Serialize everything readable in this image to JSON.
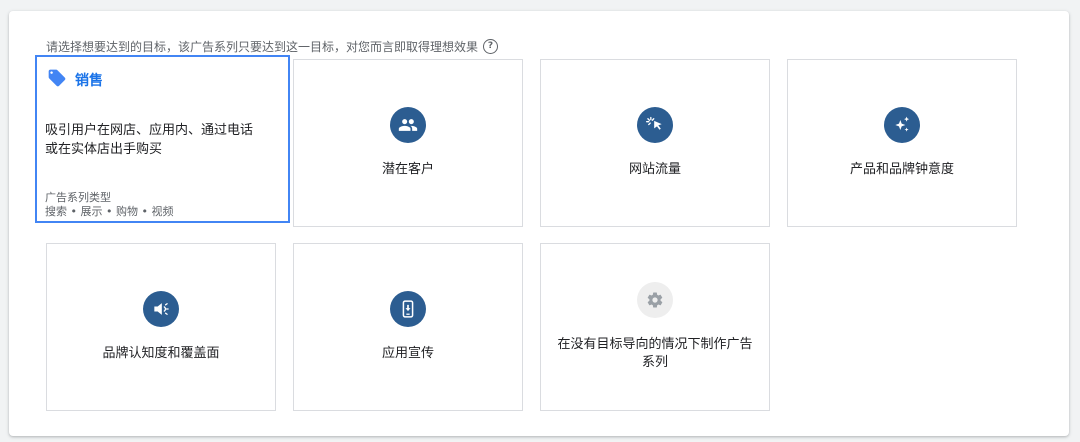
{
  "prompt": {
    "text": "请选择想要达到的目标，该广告系列只要达到这一目标，对您而言即取得理想效果",
    "help_glyph": "?"
  },
  "selected_goal": {
    "title": "销售",
    "description": "吸引用户在网店、应用内、通过电话或在实体店出手购买",
    "type_label": "广告系列类型",
    "type_values": "搜索 • 展示 • 购物 • 视频",
    "icon": "tag-icon"
  },
  "goals": {
    "leads": {
      "label": "潜在客户",
      "icon": "people-icon"
    },
    "traffic": {
      "label": "网站流量",
      "icon": "cursor-click-icon"
    },
    "consideration": {
      "label": "产品和品牌钟意度",
      "icon": "sparkle-icon"
    },
    "awareness": {
      "label": "品牌认知度和覆盖面",
      "icon": "megaphone-icon"
    },
    "app": {
      "label": "应用宣传",
      "icon": "phone-download-icon"
    },
    "no_goal": {
      "label": "在没有目标导向的情况下制作广告系列",
      "icon": "gear-icon"
    }
  },
  "colors": {
    "accent": "#1a73e8",
    "selected_border": "#4285f4",
    "icon_circle": "#2c5d91",
    "icon_circle_disabled": "#eeeeee",
    "tag_icon": "#4285f4"
  }
}
